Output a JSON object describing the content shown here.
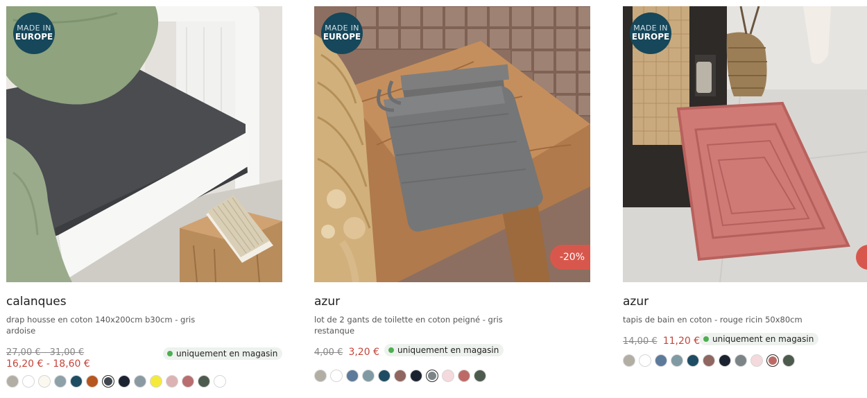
{
  "products": [
    {
      "badge_line1": "MADE IN",
      "badge_line2": "EUROPE",
      "title": "calanques",
      "description": "drap housse en coton 140x200cm b30cm - gris ardoise",
      "old_price": "27,00 € - 31,00 €",
      "new_price": "16,20 € - 18,60 €",
      "availability": "uniquement en magasin",
      "availability_color": "#4caf50",
      "swatches": [
        "#b2aea4",
        "#ffffff",
        "#fbf9ef",
        "#8ea0a8",
        "#1e4d63",
        "#b8561f",
        "#40464e",
        "#1c2330",
        "#8a9aa3",
        "#f5ea3a",
        "#dcb3b2",
        "#b96d6f",
        "#4d5b4f",
        "#ffffff"
      ],
      "selected_swatch": 6,
      "image_theme": "bed"
    },
    {
      "badge_line1": "MADE IN",
      "badge_line2": "EUROPE",
      "title": "azur",
      "description": "lot de 2 gants de toilette en coton peigné - gris restanque",
      "old_price": "4,00 €",
      "new_price": "3,20 €",
      "discount": "-20%",
      "availability": "uniquement en magasin",
      "availability_color": "#4caf50",
      "swatches": [
        "#b2aea4",
        "#ffffff",
        "#5d7a9a",
        "#7f9aa2",
        "#1e4d63",
        "#8f6660",
        "#1c2330",
        "#7c8488",
        "#f4d9dd",
        "#bd6a66",
        "#4d5b4f"
      ],
      "selected_swatch": 7,
      "image_theme": "towel"
    },
    {
      "badge_line1": "MADE IN",
      "badge_line2": "EUROPE",
      "title": "azur",
      "description": "tapis de bain en coton - rouge ricin 50x80cm",
      "old_price": "14,00 €",
      "new_price": "11,20 €",
      "availability": "uniquement en magasin",
      "availability_color": "#4caf50",
      "swatches": [
        "#b2aea4",
        "#ffffff",
        "#5d7a9a",
        "#7f9aa2",
        "#1e4d63",
        "#8f6660",
        "#1c2330",
        "#7c8488",
        "#f4d9dd",
        "#bd6a66",
        "#4d5b4f"
      ],
      "selected_swatch": 9,
      "image_theme": "bathmat"
    }
  ],
  "colors": {
    "badge_bg": "#16475a",
    "discount_bg": "#d8574c",
    "new_price": "#c4453a"
  }
}
